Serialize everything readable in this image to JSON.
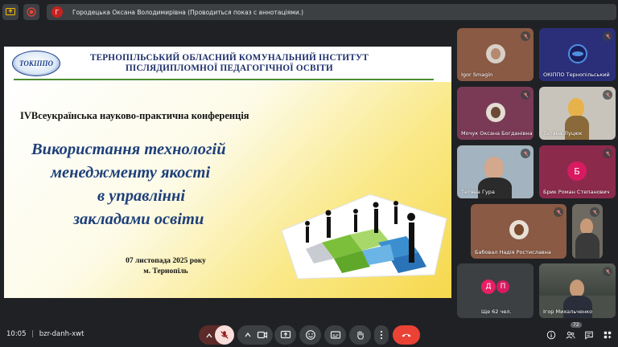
{
  "presenter": {
    "avatar_letter": "Г",
    "text": "Городецька Оксана Володимирівна (Проводиться показ с аннотаціями.)"
  },
  "slide": {
    "logo_text": "ТОКІППО",
    "institution_line1": "ТЕРНОПІЛЬСЬКИЙ ОБЛАСНИЙ КОМУНАЛЬНИЙ ІНСТИТУТ",
    "institution_line2": "ПІСЛЯДИПЛОМНОЇ ПЕДАГОГІЧНОЇ ОСВІТИ",
    "conference": "IVВсеукраїнська науково-практична конференція",
    "title_line1": "Використання технологій",
    "title_line2": "менеджменту якості",
    "title_line3": "в управлінні",
    "title_line4": "закладами освіти",
    "date": "07 листопада 2025 року",
    "place": "м. Тернопіль"
  },
  "participants": [
    {
      "name": "Igor Smagin"
    },
    {
      "name": "ОКІППО Тернопільський"
    },
    {
      "name": "Мочук Оксана Богданівна"
    },
    {
      "name": "Тетяна Луцюк"
    },
    {
      "name": "Тетяна Гура"
    },
    {
      "name": "Брик Роман Степанович",
      "avatar_letter": "Б"
    },
    {
      "name": "Бабовал Надія Ростиславна"
    },
    {
      "name": ""
    },
    {
      "name": "Ще 62 чел.",
      "avatar_letters": [
        "Д",
        "П"
      ]
    },
    {
      "name": "Ігор Михальченко"
    }
  ],
  "bottom_bar": {
    "time": "10:05",
    "separator": "|",
    "meeting_code": "bzr-danh-xwt",
    "participant_count": "72"
  },
  "colors": {
    "background": "#202124",
    "control": "#3c4043",
    "hangup": "#ea4335",
    "mic_off": "#f28b82",
    "title_blue": "#1e3f7a"
  }
}
